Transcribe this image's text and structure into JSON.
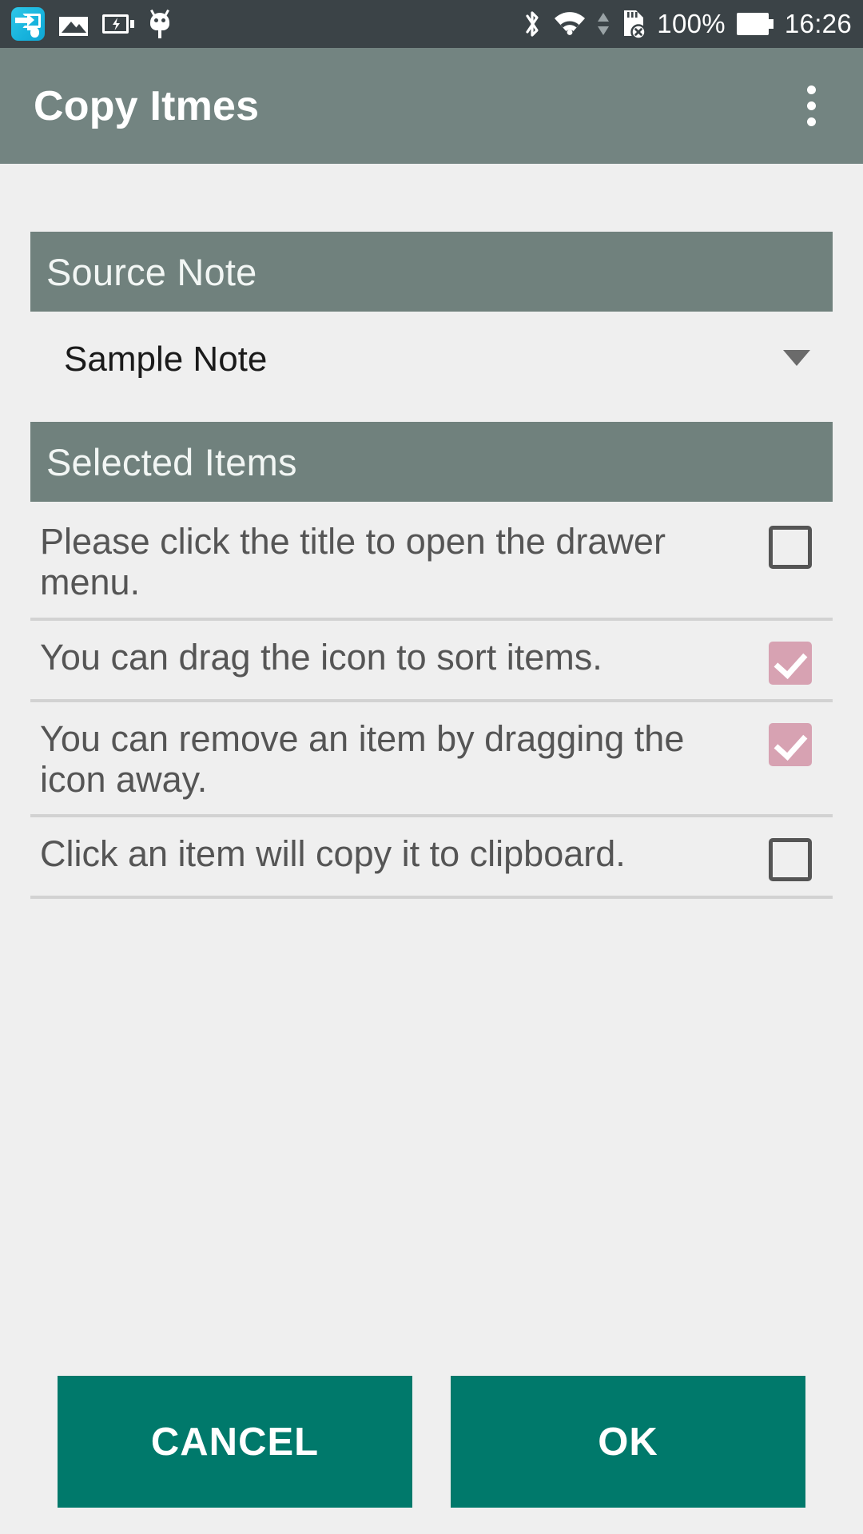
{
  "status_bar": {
    "time": "16:26",
    "battery_percent": "100%",
    "background_color": "#3b4347",
    "left_icons": [
      {
        "name": "screen-cast-app-icon",
        "glyph": "cast-app"
      },
      {
        "name": "gallery-image-icon",
        "glyph": "image"
      },
      {
        "name": "battery-charging-icon",
        "glyph": "battery-bolt"
      },
      {
        "name": "usb-debugging-icon",
        "glyph": "android-bug"
      }
    ],
    "right_icons": [
      {
        "name": "bluetooth-icon",
        "glyph": "bluetooth"
      },
      {
        "name": "wifi-icon",
        "glyph": "wifi"
      },
      {
        "name": "data-transfer-arrows-icon",
        "glyph": "up-down-arrows"
      },
      {
        "name": "sd-card-error-icon",
        "glyph": "sdcard-x"
      },
      {
        "name": "battery-full-icon",
        "glyph": "battery-full"
      }
    ]
  },
  "app_bar": {
    "title": "Copy Itmes",
    "overflow_label": "More options",
    "background_color": "#738481"
  },
  "colors": {
    "section_header_bg": "#70817d",
    "content_bg": "#efefef",
    "checkbox_checked": "#d7a2b2",
    "checkbox_unchecked_border": "#555555",
    "button_bg": "#00796b",
    "divider": "#d2d2d2"
  },
  "source_note": {
    "header": "Source Note",
    "selected_value": "Sample Note",
    "dropdown_icon": "chevron-down-icon"
  },
  "selected_items": {
    "header": "Selected Items",
    "rows": [
      {
        "text": "Please click the title to open the drawer menu.",
        "checked": false
      },
      {
        "text": "You can drag the icon to sort items.",
        "checked": true
      },
      {
        "text": "You can remove an item by dragging the icon away.",
        "checked": true
      },
      {
        "text": "Click an item will copy it to clipboard.",
        "checked": false
      }
    ]
  },
  "buttons": {
    "cancel": "CANCEL",
    "ok": "OK"
  }
}
